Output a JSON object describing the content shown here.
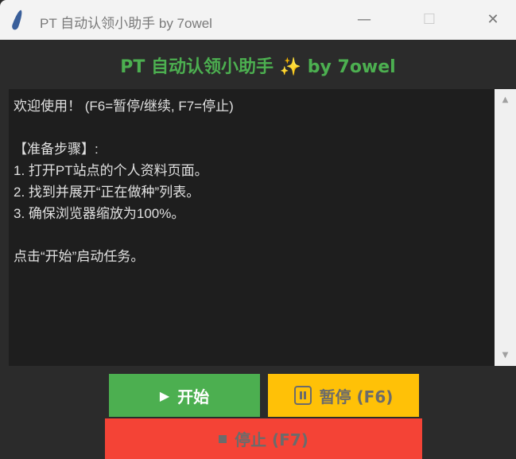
{
  "window": {
    "title": "PT 自动认领小助手 by 7owel",
    "minimize": "—",
    "maximize": "☐",
    "close": "✕"
  },
  "header": {
    "title": "PT 自动认领小助手 ✨ by 7owel"
  },
  "log": {
    "lines": [
      "欢迎使用！ (F6=暂停/继续, F7=停止)",
      "",
      "【准备步骤】:",
      "1. 打开PT站点的个人资料页面。",
      "2. 找到并展开“正在做种”列表。",
      "3. 确保浏览器缩放为100%。",
      "",
      "点击“开始”启动任务。"
    ]
  },
  "buttons": {
    "start": "开始",
    "start_icon": "▶",
    "pause": "暂停 (F6)",
    "stop": "停止 (F7)"
  },
  "colors": {
    "accent": "#4caf50",
    "pause": "#ffc107",
    "stop": "#f44336"
  }
}
